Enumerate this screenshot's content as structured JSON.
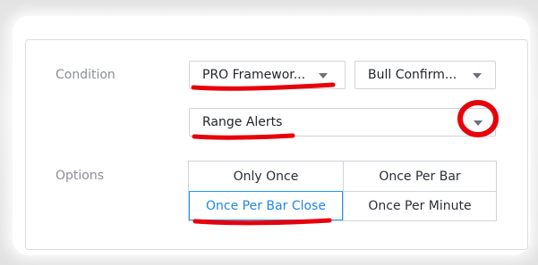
{
  "condition": {
    "label": "Condition",
    "primary_select": "PRO Framewor...",
    "secondary_select": "Bull Confirm...",
    "alert_select": "Range Alerts"
  },
  "options": {
    "label": "Options",
    "items": [
      "Only Once",
      "Once Per Bar",
      "Once Per Bar Close",
      "Once Per Minute"
    ],
    "selected": "Once Per Bar Close"
  },
  "icons": {
    "dropdown": "chevron-down-icon"
  },
  "colors": {
    "selected_text": "#1e88e5",
    "selected_border": "#2196f3",
    "annotation": "#e8000b"
  }
}
